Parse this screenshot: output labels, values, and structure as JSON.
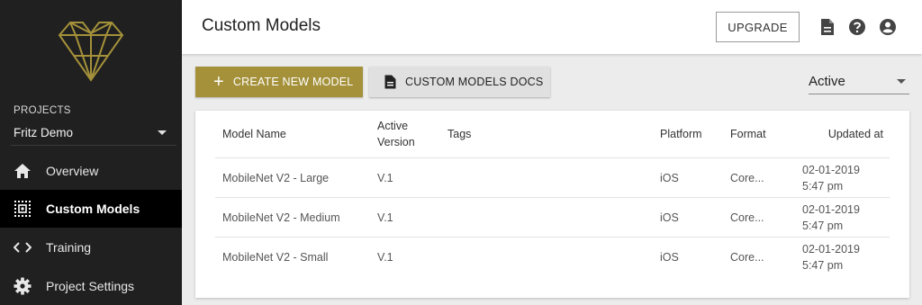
{
  "sidebar": {
    "logo": "diamond-heart-logo",
    "projects_label": "PROJECTS",
    "project_name": "Fritz Demo",
    "items": [
      {
        "label": "Overview",
        "icon": "home-icon"
      },
      {
        "label": "Custom Models",
        "icon": "model-chip-icon"
      },
      {
        "label": "Training",
        "icon": "code-icon"
      },
      {
        "label": "Project Settings",
        "icon": "gear-icon"
      }
    ]
  },
  "header": {
    "title": "Custom Models",
    "upgrade_label": "UPGRADE"
  },
  "toolbar": {
    "create_label": "CREATE NEW MODEL",
    "create_symbol": "+",
    "docs_label": "CUSTOM MODELS DOCS",
    "filter_value": "Active"
  },
  "table": {
    "columns": {
      "name": "Model Name",
      "version_line1": "Active",
      "version_line2": "Version",
      "tags": "Tags",
      "platform": "Platform",
      "format": "Format",
      "updated": "Updated at"
    },
    "rows": [
      {
        "name": "MobileNet V2 - Large",
        "version": "V.1",
        "tags": "",
        "platform": "iOS",
        "format": "Core...",
        "date": "02-01-2019",
        "time": "5:47 pm"
      },
      {
        "name": "MobileNet V2 - Medium",
        "version": "V.1",
        "tags": "",
        "platform": "iOS",
        "format": "Core...",
        "date": "02-01-2019",
        "time": "5:47 pm"
      },
      {
        "name": "MobileNet V2 - Small",
        "version": "V.1",
        "tags": "",
        "platform": "iOS",
        "format": "Core...",
        "date": "02-01-2019",
        "time": "5:47 pm"
      }
    ]
  },
  "colors": {
    "accent": "#a4913a",
    "sidebar_bg": "#202020",
    "active_nav_bg": "#000000"
  }
}
